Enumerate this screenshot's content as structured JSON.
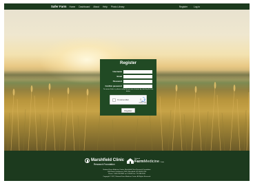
{
  "nav": {
    "brand": "Safer Farm",
    "links": [
      "Home",
      "Dashboard",
      "About",
      "Help",
      "Photo Library"
    ],
    "right_links": [
      "Register",
      "Log in"
    ]
  },
  "register": {
    "title": "Register",
    "fields": [
      {
        "label": "Username",
        "value": ""
      },
      {
        "label": "Email",
        "value": ""
      },
      {
        "label": "Password",
        "value": ""
      },
      {
        "label": "Confirm password",
        "value": ""
      }
    ],
    "notice": "To ensure Safer is, please verify that you are a human by checking the box below.",
    "captcha": {
      "label": "I'm not a robot",
      "privacy": "reCAPTCHA Privacy - Terms"
    },
    "submit_label": "Register"
  },
  "footer": {
    "org1": {
      "name": "Marshfield Clinic",
      "sub": "Research Foundation"
    },
    "org2": {
      "prefix": "National",
      "brand_bold": "Farm",
      "brand_rest": "Medicine",
      "suffix": "Center"
    },
    "address_lines": [
      "National Farm Medicine Center, Marshfield Clinic Research Foundation",
      "1000 North Oak Avenue, MLB, Marshfield, WI 54449-5790",
      "Phone: 1-800-782-8581 ext. 9-2440 Fax: 715-389-3535",
      "Copyright © 2017, National Farm Medicine Center. All Rights Reserved."
    ]
  },
  "colors": {
    "nav_bg": "#1c3a1e",
    "card_bg": "#214a24",
    "footer_bg": "#1c3a1e"
  }
}
